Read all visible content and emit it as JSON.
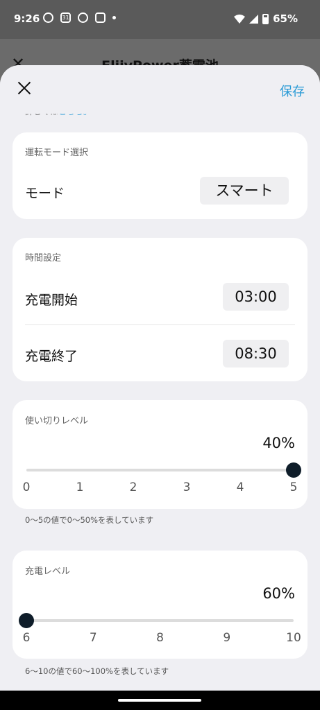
{
  "status_bar": {
    "time": "9:26",
    "calendar_day": "31",
    "battery": "65%"
  },
  "background": {
    "title": "EliivPower蓄電池"
  },
  "header": {
    "save_label": "保存"
  },
  "cut_note": {
    "text": "詳しくは",
    "link": "こちら。"
  },
  "mode_card": {
    "title": "運転モード選択",
    "label": "モード",
    "value": "スマート"
  },
  "time_card": {
    "title": "時間設定",
    "start_label": "充電開始",
    "start_value": "03:00",
    "end_label": "充電終了",
    "end_value": "08:30"
  },
  "usage_card": {
    "title": "使い切りレベル",
    "percent": "40%",
    "ticks": [
      "0",
      "1",
      "2",
      "3",
      "4",
      "5"
    ],
    "level": 5,
    "caption": "0〜5の値で0〜50%を表しています"
  },
  "charge_card": {
    "title": "充電レベル",
    "percent": "60%",
    "ticks": [
      "6",
      "7",
      "8",
      "9",
      "10"
    ],
    "level": 6,
    "caption": "6〜10の値で60〜100%を表しています"
  },
  "colors": {
    "accent": "#2a9bd6",
    "thumb": "#0f1d2a",
    "sheet_bg": "#efeff3"
  }
}
